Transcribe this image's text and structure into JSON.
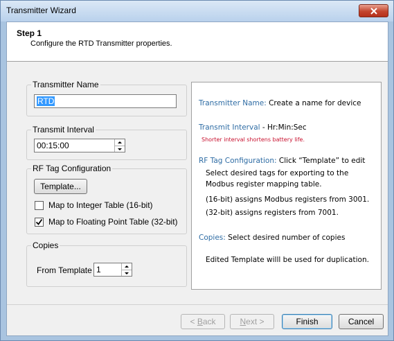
{
  "window": {
    "title": "Transmitter Wizard"
  },
  "header": {
    "step_title": "Step 1",
    "step_subtitle": "Configure the RTD Transmitter properties."
  },
  "transmitter_name": {
    "group_label": "Transmitter Name",
    "value": "RTD"
  },
  "transmit_interval": {
    "group_label": "Transmit Interval",
    "value": "00:15:00"
  },
  "rf_tag": {
    "group_label": "RF Tag Configuration",
    "template_button": "Template...",
    "map_integer": {
      "label": "Map to Integer Table (16-bit)",
      "checked": false
    },
    "map_float": {
      "label": "Map to Floating Point Table (32-bit)",
      "checked": true
    }
  },
  "copies": {
    "group_label": "Copies",
    "from_template_label": "From Template",
    "value": "1"
  },
  "help": {
    "name_title": "Transmitter Name:",
    "name_text": " Create a name for device",
    "interval_title": "Transmit Interval",
    "interval_text": " - Hr:Min:Sec",
    "interval_note": "Shorter interval shortens battery life.",
    "rf_title": "RF Tag Configuration:",
    "rf_text": " Click “Template” to edit",
    "rf_line2": "Select desired tags for exporting to the",
    "rf_line3": "Modbus register mapping table.",
    "rf_16bit": "(16-bit) assigns Modbus registers from 3001.",
    "rf_32bit": "(32-bit) assigns registers from 7001.",
    "copies_title": "Copies:",
    "copies_text": " Select desired number of copies",
    "copies_note": "Edited Template willl be used for duplication."
  },
  "footer": {
    "back_prefix": "< ",
    "back_key": "B",
    "back_rest": "ack",
    "next_key": "N",
    "next_rest": "ext >",
    "finish": "Finish",
    "cancel": "Cancel"
  },
  "colors": {
    "help_title": "#2e6ca4",
    "warning": "#c8102e",
    "selection": "#3399ff"
  }
}
